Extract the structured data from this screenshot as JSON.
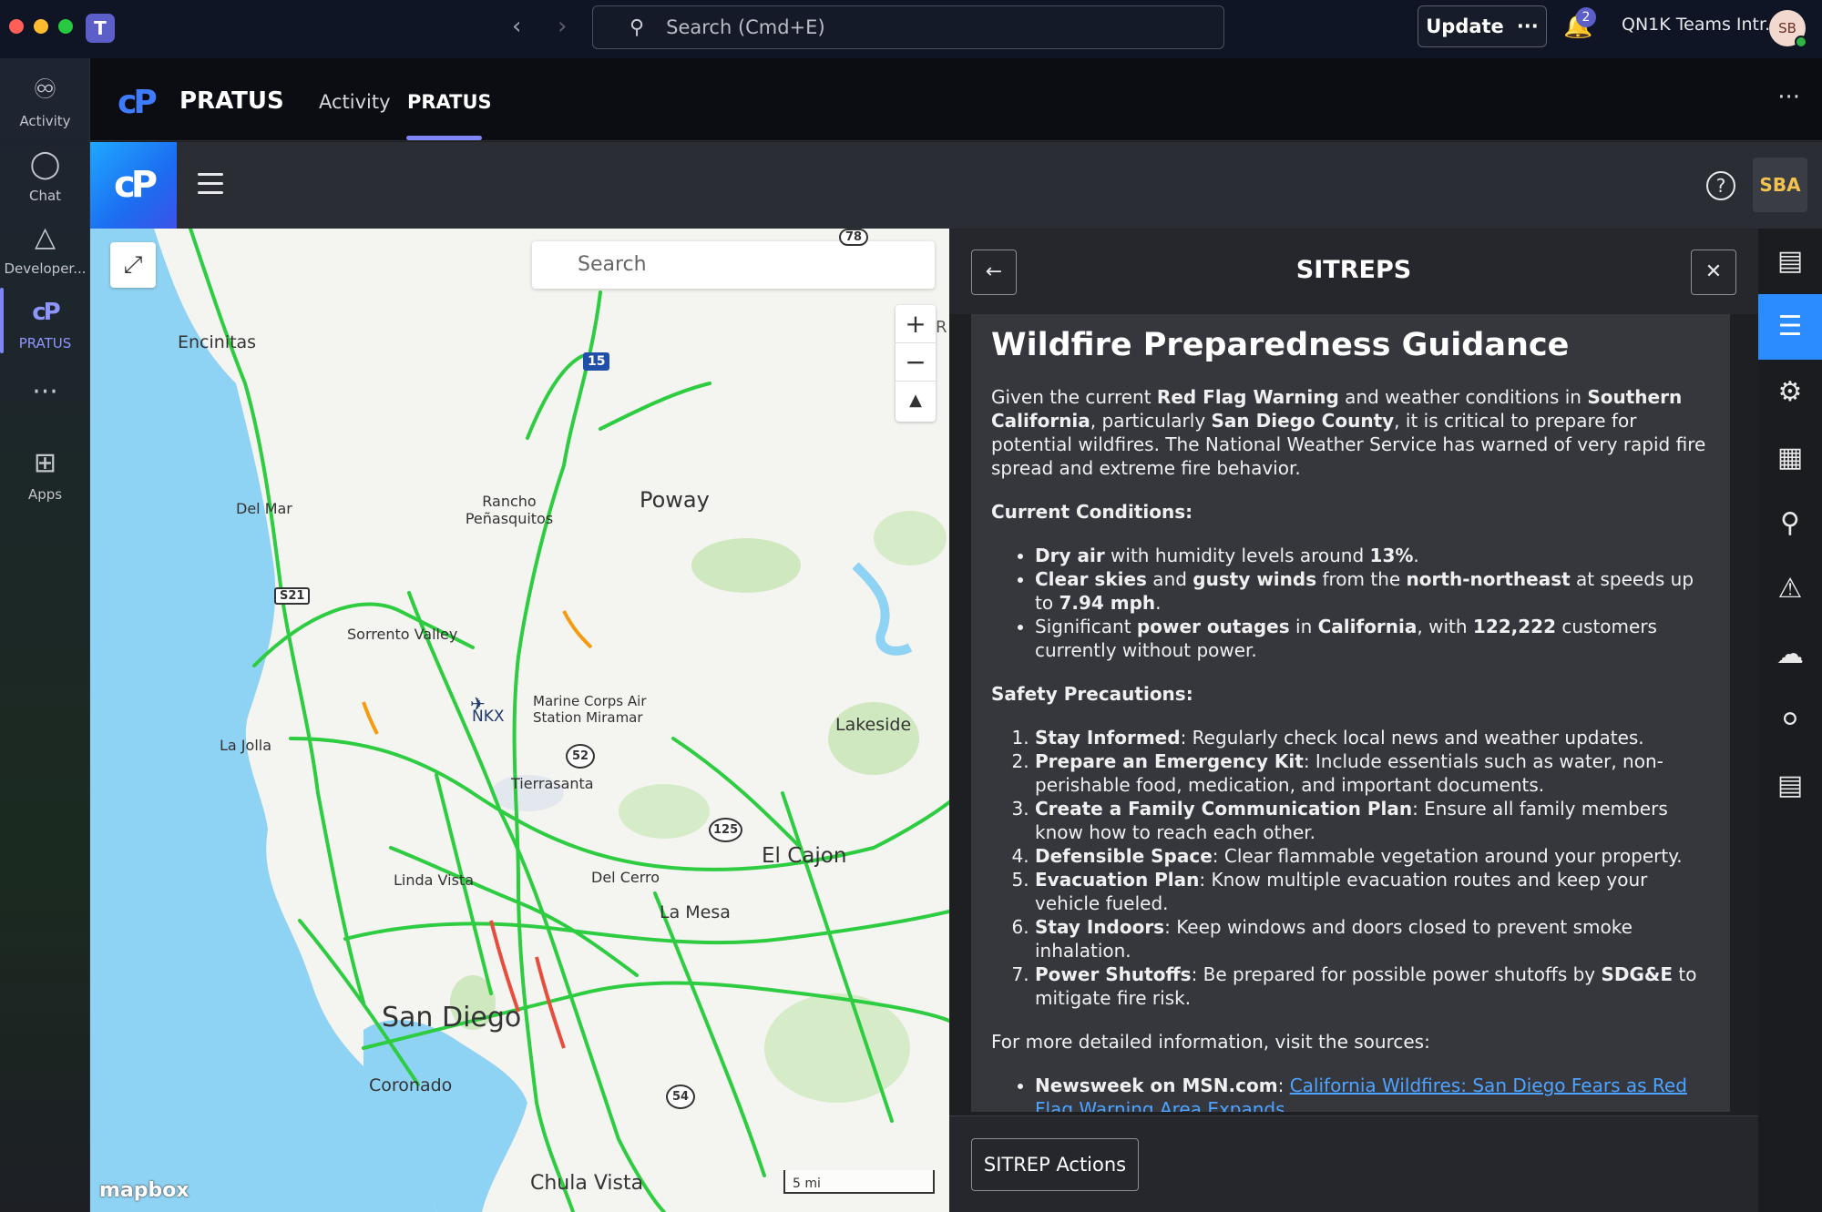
{
  "titlebar": {
    "search_placeholder": "Search (Cmd+E)",
    "update_label": "Update",
    "update_more": "···",
    "notif_count": "2",
    "org_name": "QN1K Teams Intr...",
    "avatar_initials": "SB",
    "teams_logo": "T"
  },
  "rail": {
    "items": [
      {
        "label": "Activity",
        "icon": "bell-icon"
      },
      {
        "label": "Chat",
        "icon": "chat-icon"
      },
      {
        "label": "Developer...",
        "icon": "developer-icon"
      },
      {
        "label": "PRATUS",
        "icon": "pratus-icon"
      },
      {
        "label": "",
        "icon": "more-icon"
      },
      {
        "label": "Apps",
        "icon": "add-app-icon"
      }
    ]
  },
  "header": {
    "app_name": "PRATUS",
    "tabs": [
      {
        "label": "Activity"
      },
      {
        "label": "PRATUS"
      }
    ]
  },
  "toolbar": {
    "user_badge": "SBA",
    "help": "?"
  },
  "map": {
    "search_placeholder": "Search",
    "attribution": "mapbox",
    "scale_label": "5 mi",
    "places": [
      {
        "name": "Encinitas"
      },
      {
        "name": "Poway"
      },
      {
        "name": "Rancho Peñasquitos"
      },
      {
        "name": "Del Mar"
      },
      {
        "name": "Sorrento Valley"
      },
      {
        "name": "NKX"
      },
      {
        "name": "Marine Corps Air Station Miramar"
      },
      {
        "name": "La Jolla"
      },
      {
        "name": "Lakeside"
      },
      {
        "name": "Tierrasanta"
      },
      {
        "name": "El Cajon"
      },
      {
        "name": "Linda Vista"
      },
      {
        "name": "Del Cerro"
      },
      {
        "name": "La Mesa"
      },
      {
        "name": "San Diego"
      },
      {
        "name": "Coronado"
      },
      {
        "name": "Chula Vista"
      }
    ],
    "shields": [
      "15",
      "S21",
      "52",
      "125",
      "54",
      "78"
    ],
    "edge_letter": "R"
  },
  "panel": {
    "title": "SITREPS",
    "doc_title": "Wildfire Preparedness Guidance",
    "intro": {
      "p1": "Given the current ",
      "b1": "Red Flag Warning",
      "p2": " and weather conditions in ",
      "b2": "Southern California",
      "p3": ", particularly ",
      "b3": "San Diego County",
      "p4": ", it is critical to prepare for potential wildfires. The National Weather Service has warned of very rapid fire spread and extreme fire behavior."
    },
    "conditions_heading": "Current Conditions:",
    "conditions": {
      "c1b": "Dry air",
      "c1t": " with humidity levels around ",
      "c1v": "13%",
      "c1e": ".",
      "c2b1": "Clear skies",
      "c2t1": " and ",
      "c2b2": "gusty winds",
      "c2t2": " from the ",
      "c2b3": "north-northeast",
      "c2t3": " at speeds up to ",
      "c2v": "7.94 mph",
      "c2e": ".",
      "c3t1": "Significant ",
      "c3b1": "power outages",
      "c3t2": " in ",
      "c3b2": "California",
      "c3t3": ", with ",
      "c3v": "122,222",
      "c3t4": " customers currently without power."
    },
    "safety_heading": "Safety Precautions:",
    "safety": [
      {
        "b": "Stay Informed",
        "t": ": Regularly check local news and weather updates."
      },
      {
        "b": "Prepare an Emergency Kit",
        "t": ": Include essentials such as water, non-perishable food, medication, and important documents."
      },
      {
        "b": "Create a Family Communication Plan",
        "t": ": Ensure all family members know how to reach each other."
      },
      {
        "b": "Defensible Space",
        "t": ": Clear flammable vegetation around your property."
      },
      {
        "b": "Evacuation Plan",
        "t": ": Know multiple evacuation routes and keep your vehicle fueled."
      },
      {
        "b": "Stay Indoors",
        "t": ": Keep windows and doors closed to prevent smoke inhalation."
      },
      {
        "b": "Power Shutoffs",
        "t": ": Be prepared for possible power shutoffs by ",
        "b2": "SDG&E",
        "t2": " to mitigate fire risk."
      }
    ],
    "sources_intro": "For more detailed information, visit the sources:",
    "sources": [
      {
        "name": "Newsweek on MSN.com",
        "sep": ": ",
        "link": "California Wildfires: San Diego Fears as Red Flag Warning Area Expands"
      }
    ],
    "actions_label": "SITREP Actions"
  },
  "colors": {
    "accent": "#2b8cff",
    "teams_purple": "#7f85f5",
    "traffic_green": "#2ecc40",
    "link": "#4da3ff"
  }
}
